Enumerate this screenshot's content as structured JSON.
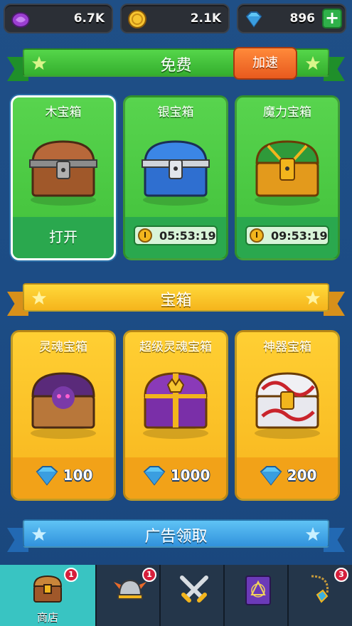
{
  "currencies": {
    "soul": "6.7K",
    "gold": "2.1K",
    "gems": "896",
    "plus": "+"
  },
  "free_section": {
    "title": "免费",
    "speed_button": "加速",
    "cards": [
      {
        "name": "木宝箱",
        "action": "打开"
      },
      {
        "name": "银宝箱",
        "timer": "05:53:19"
      },
      {
        "name": "魔力宝箱",
        "timer": "09:53:19"
      }
    ]
  },
  "chest_section": {
    "title": "宝箱",
    "cards": [
      {
        "name": "灵魂宝箱",
        "price": "100"
      },
      {
        "name": "超级灵魂宝箱",
        "price": "1000"
      },
      {
        "name": "神器宝箱",
        "price": "200"
      }
    ]
  },
  "ad_section": {
    "title": "广告领取"
  },
  "nav": {
    "items": [
      {
        "label": "商店",
        "badge": "1"
      },
      {
        "label": "",
        "badge": "1"
      },
      {
        "label": "",
        "badge": ""
      },
      {
        "label": "",
        "badge": ""
      },
      {
        "label": "",
        "badge": "3"
      }
    ]
  },
  "colors": {
    "background": "#1c4c85",
    "green": "#41c03a",
    "yellow": "#f7b51d",
    "blue": "#3192dd",
    "nav_active": "#39c4c2"
  }
}
